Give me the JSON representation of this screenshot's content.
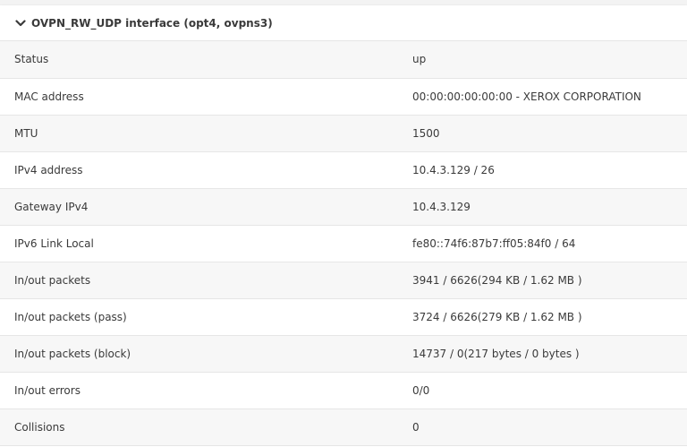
{
  "panel": {
    "title": "OVPN_RW_UDP interface (opt4, ovpns3)",
    "expand_icon": "chevron-down-icon"
  },
  "rows": [
    {
      "label": "Status",
      "value": "up"
    },
    {
      "label": "MAC address",
      "value": "00:00:00:00:00:00 - XEROX CORPORATION"
    },
    {
      "label": "MTU",
      "value": "1500"
    },
    {
      "label": "IPv4 address",
      "value": "10.4.3.129 / 26"
    },
    {
      "label": "Gateway IPv4",
      "value": "10.4.3.129"
    },
    {
      "label": "IPv6 Link Local",
      "value": "fe80::74f6:87b7:ff05:84f0 / 64"
    },
    {
      "label": "In/out packets",
      "value": "3941 / 6626(294 KB / 1.62 MB )"
    },
    {
      "label": "In/out packets (pass)",
      "value": "3724 / 6626(279 KB / 1.62 MB )"
    },
    {
      "label": "In/out packets (block)",
      "value": "14737 / 0(217 bytes / 0 bytes )"
    },
    {
      "label": "In/out errors",
      "value": "0/0"
    },
    {
      "label": "Collisions",
      "value": "0"
    }
  ]
}
